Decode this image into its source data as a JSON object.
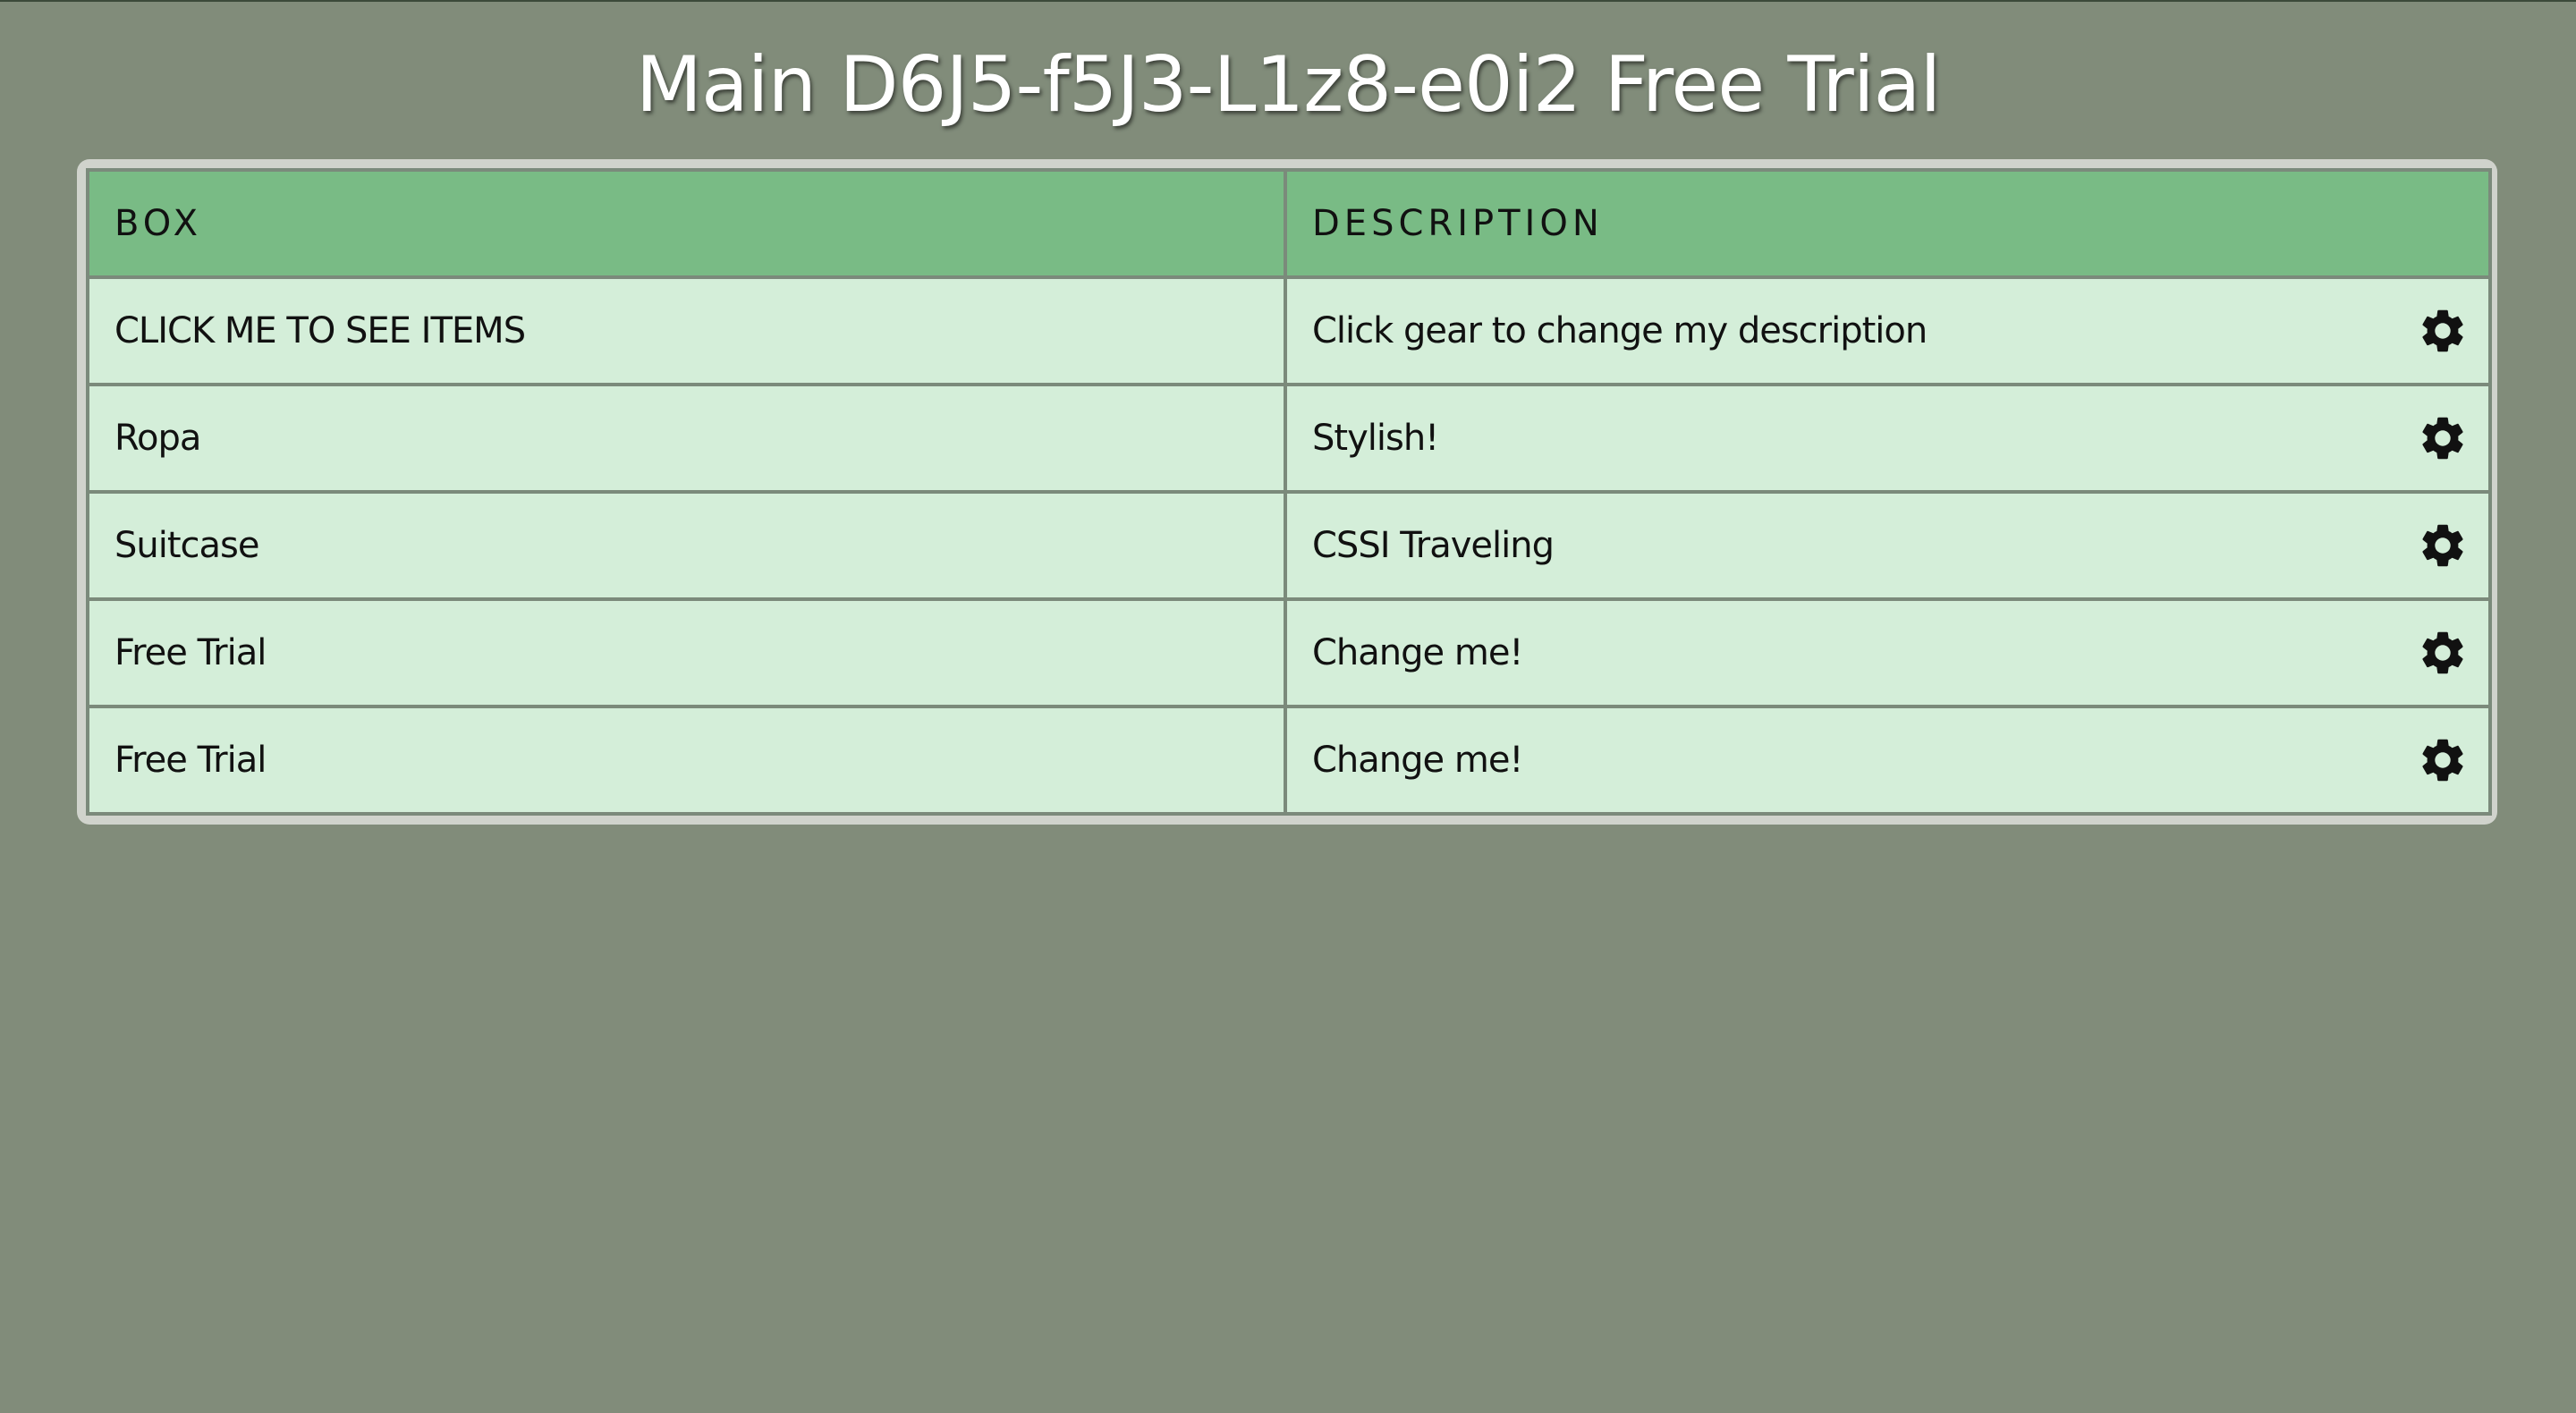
{
  "page": {
    "title": "Main D6J5-f5J3-L1z8-e0i2 Free Trial"
  },
  "table": {
    "headers": {
      "box": "BOX",
      "description": "DESCRIPTION"
    },
    "rows": [
      {
        "box": "CLICK ME TO SEE ITEMS",
        "description": "Click gear to change my description",
        "action_icon": "gear-icon"
      },
      {
        "box": "Ropa",
        "description": "Stylish!",
        "action_icon": "gear-icon"
      },
      {
        "box": "Suitcase",
        "description": "CSSI Traveling",
        "action_icon": "gear-icon"
      },
      {
        "box": "Free Trial",
        "description": "Change me!",
        "action_icon": "gear-icon"
      },
      {
        "box": "Free Trial",
        "description": "Change me!",
        "action_icon": "gear-icon"
      }
    ]
  },
  "colors": {
    "background": "#818c7a",
    "header_bg": "#79bb85",
    "row_bg": "#d4eed9",
    "frame": "#d0d3cc",
    "title_text": "#ffffff"
  }
}
